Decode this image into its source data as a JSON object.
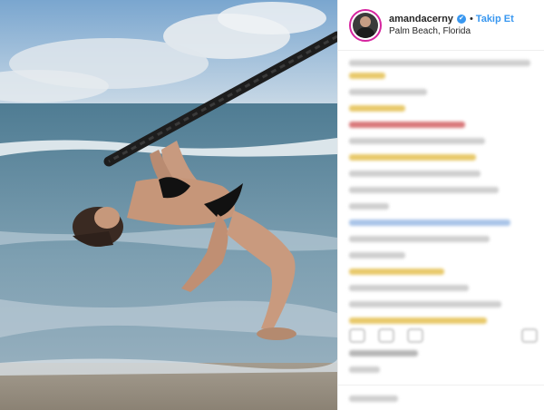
{
  "post": {
    "username": "amandacerny",
    "verified": true,
    "verified_icon": "✔",
    "separator": "•",
    "follow_label": "Takip Et",
    "location": "Palm Beach, Florida"
  },
  "colors": {
    "accent": "#3897f0",
    "story_ring": "#d6249f",
    "text": "#262626"
  },
  "icons": [
    "verified-badge-icon",
    "heart-icon",
    "comment-icon",
    "share-icon",
    "bookmark-icon"
  ]
}
